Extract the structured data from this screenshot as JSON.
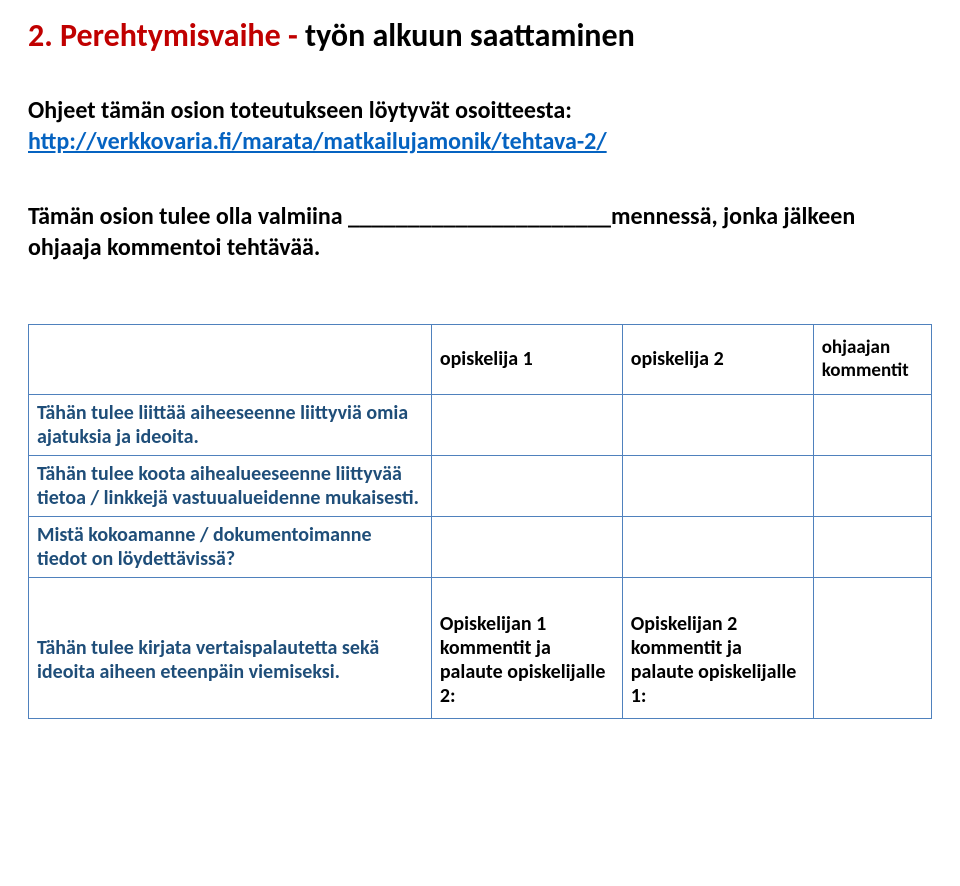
{
  "heading": {
    "number": "2.",
    "title": "Perehtymisvaihe",
    "dash": "-",
    "subtitle": "työn alkuun saattaminen"
  },
  "intro": {
    "line1": "Ohjeet tämän osion toteutukseen löytyvät osoitteesta:",
    "link": "http://verkkovaria.fi/marata/matkailujamonik/tehtava-2/"
  },
  "paragraph2": {
    "before": "Tämän osion tulee olla valmiina ",
    "blank": "______________________",
    "after": "mennessä, jonka jälkeen ohjaaja kommentoi tehtävää."
  },
  "table1": {
    "headers": {
      "empty": "",
      "col1": "opiskelija 1",
      "col2": "opiskelija 2",
      "col3": "ohjaajan kommentit"
    },
    "rows": [
      {
        "label": "Tähän tulee liittää aiheeseenne liittyviä omia ajatuksia ja ideoita.",
        "c1": "",
        "c2": "",
        "c3": ""
      },
      {
        "label": "Tähän tulee koota aihealueeseenne liittyvää tietoa / linkkejä vastuualueidenne mukaisesti.",
        "c1": "",
        "c2": "",
        "c3": ""
      },
      {
        "label": "Mistä kokoamanne / dokumentoimanne tiedot on löydettävissä?",
        "c1": "",
        "c2": "",
        "c3": ""
      }
    ],
    "feedback": {
      "label": "Tähän tulee kirjata vertaispalautetta sekä ideoita aiheen eteenpäin viemiseksi.",
      "c1": "Opiskelijan 1 kommentit ja palaute opiskelijalle 2:",
      "c2": "Opiskelijan 2 kommentit ja palaute opiskelijalle 1:",
      "c3": ""
    }
  }
}
